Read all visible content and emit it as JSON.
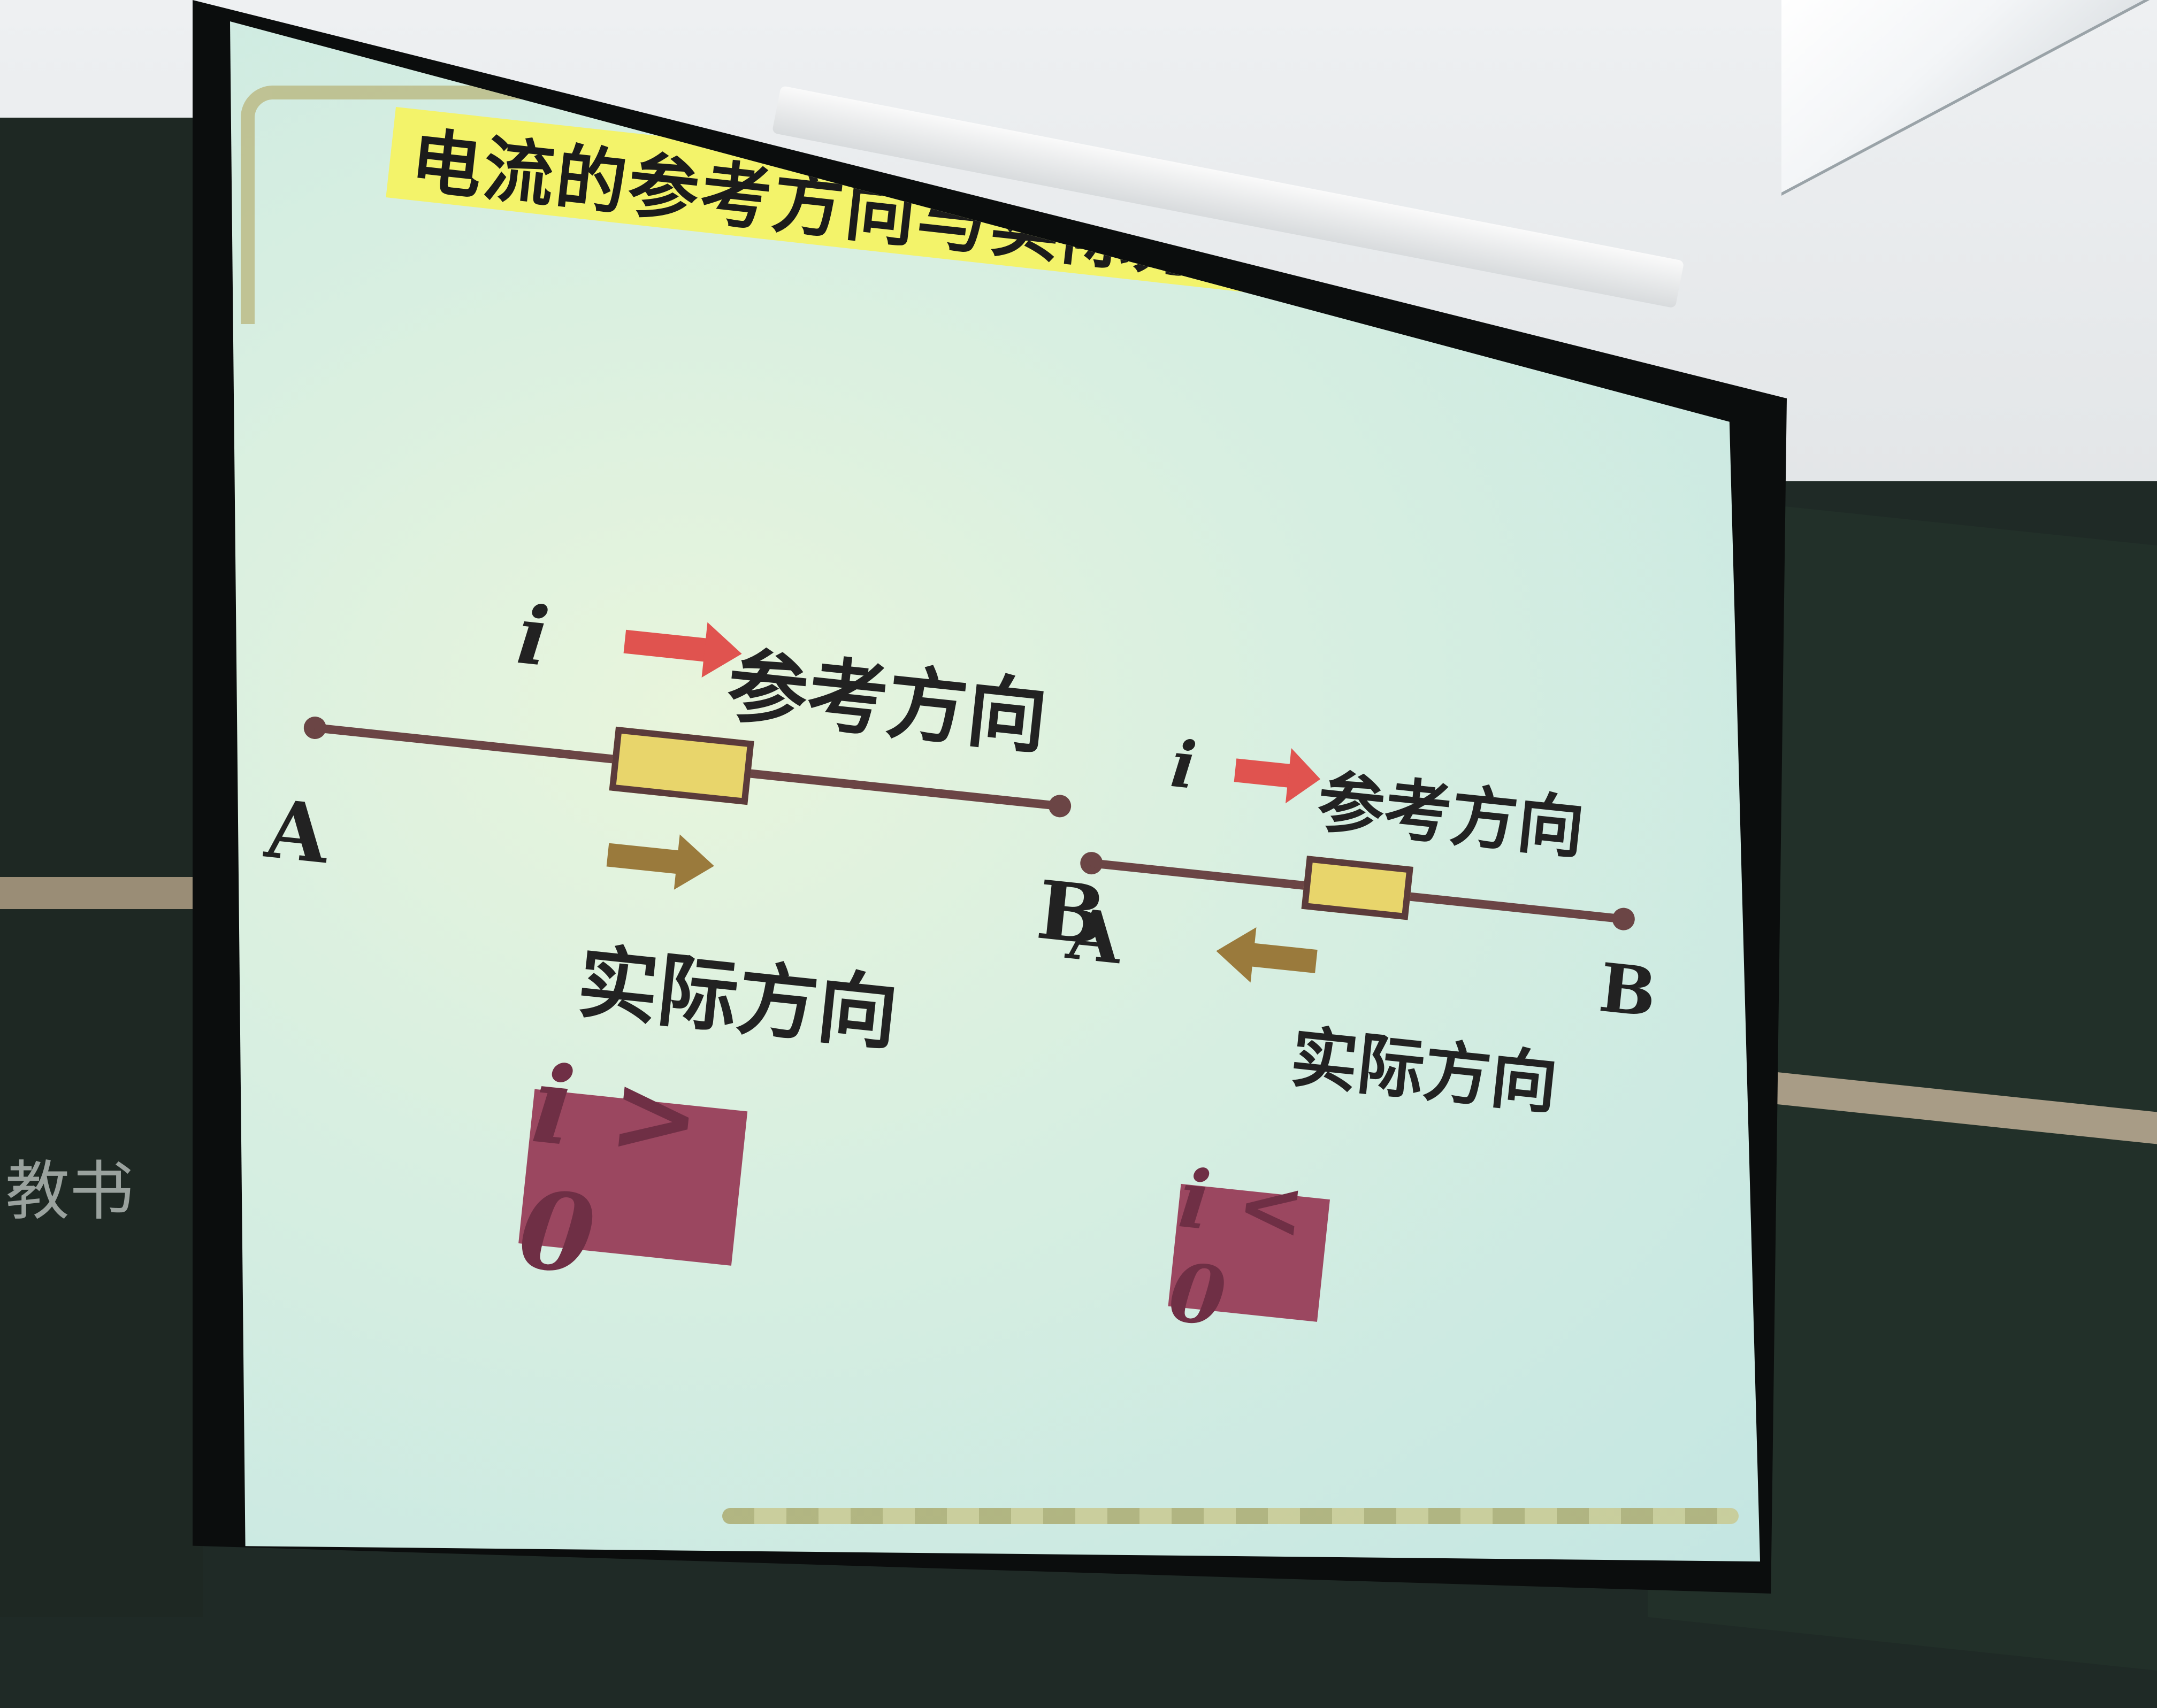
{
  "slide": {
    "title": "电流的参考方向与实际方向的关系:"
  },
  "left_circuit": {
    "current_symbol": "i",
    "reference_label": "参考方向",
    "actual_label": "实际方向",
    "node_a": "A",
    "node_b": "B",
    "condition": "i > 0"
  },
  "right_circuit": {
    "current_symbol": "i",
    "reference_label": "参考方向",
    "actual_label": "实际方向",
    "node_a": "A",
    "node_b": "B",
    "condition": "i < 0"
  },
  "colors": {
    "title_highlight": "#f3f36a",
    "reference_arrow": "#e0534f",
    "actual_arrow": "#9a7a3c",
    "wire": "#6b4545",
    "resistor_fill": "#e8d56b",
    "condition_badge": "#9b4760"
  },
  "background": {
    "chalk_text": "教书"
  }
}
